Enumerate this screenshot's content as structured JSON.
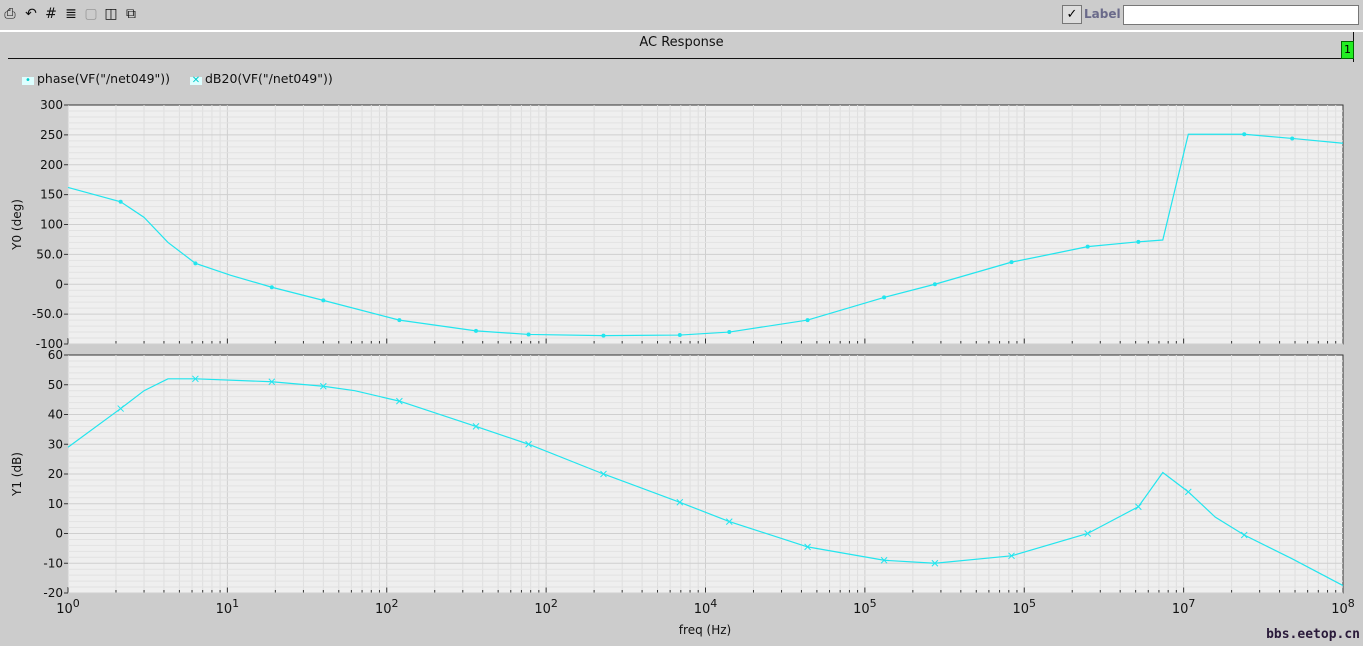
{
  "toolbar": {
    "icons": [
      "print-icon",
      "undo-icon",
      "grid-icon",
      "strips-icon",
      "panel-icon",
      "split-icon",
      "detach-icon"
    ],
    "label_checkbox": true,
    "label_text": "Label",
    "label_input": ""
  },
  "title": "AC Response",
  "page_indicator": "1",
  "watermark": "bbs.eetop.cn",
  "chart_data": [
    {
      "type": "line",
      "ylabel": "Y0 (deg)",
      "ylim": [
        -100,
        300
      ],
      "yticks": [
        "300",
        "250",
        "200",
        "150",
        "100",
        "50.0",
        "0",
        "-50.0",
        "-100"
      ],
      "xscale": "log",
      "xlim": [
        1,
        100000000
      ],
      "grid": true,
      "color": "#22e5ee",
      "marker": "dot",
      "series": [
        {
          "name": "phase(VF(\"/net049\"))",
          "x": [
            1,
            2.14,
            3.0,
            4.24,
            6.3,
            10.5,
            19,
            40,
            120,
            363,
            776,
            2290,
            6900,
            14100,
            43700,
            132000,
            275000,
            832000,
            1450000,
            2500000,
            5200000,
            7400000,
            10700000,
            24000000,
            48000000,
            100000000
          ],
          "y": [
            162,
            138,
            112,
            70,
            35,
            15,
            -5,
            -27,
            -60,
            -78,
            -84,
            -86,
            -85,
            -80,
            -60,
            -22,
            0,
            37,
            50,
            63,
            71,
            74,
            251,
            251,
            244,
            236
          ],
          "markers": [
            1,
            4,
            6,
            7,
            8,
            9,
            10,
            11,
            12,
            13,
            14,
            15,
            16,
            17,
            19,
            20,
            23,
            24
          ]
        }
      ]
    },
    {
      "type": "line",
      "ylabel": "Y1 (dB)",
      "xlabel": "freq (Hz)",
      "ylim": [
        -20,
        60
      ],
      "yticks": [
        "60",
        "50",
        "40",
        "30",
        "20",
        "10",
        "0",
        "-10",
        "-20"
      ],
      "xscale": "log",
      "xlim": [
        1,
        100000000
      ],
      "xticks": [
        {
          "v": 1,
          "b": "10",
          "e": "0"
        },
        {
          "v": 10,
          "b": "10",
          "e": "1"
        },
        {
          "v": 100,
          "b": "10",
          "e": "2"
        },
        {
          "v": 1000,
          "b": "10",
          "e": "2"
        },
        {
          "v": 10000,
          "b": "10",
          "e": "4"
        },
        {
          "v": 100000,
          "b": "10",
          "e": "5"
        },
        {
          "v": 1000000,
          "b": "10",
          "e": "5"
        },
        {
          "v": 10000000,
          "b": "10",
          "e": "7"
        },
        {
          "v": 100000000,
          "b": "10",
          "e": "8"
        }
      ],
      "grid": true,
      "color": "#22e5ee",
      "marker": "x",
      "series": [
        {
          "name": "dB20(VF(\"/net049\"))",
          "x": [
            1,
            2.14,
            3.0,
            4.24,
            6.3,
            19,
            40,
            63,
            120,
            363,
            776,
            2290,
            6900,
            14100,
            43700,
            132000,
            275000,
            832000,
            2500000,
            5200000,
            7400000,
            10700000,
            15800000,
            24000000,
            48000000,
            100000000
          ],
          "y": [
            29,
            42,
            48,
            52,
            52,
            51,
            49.5,
            48,
            44.5,
            36,
            30,
            20,
            10.5,
            4,
            -4.5,
            -9,
            -10,
            -7.5,
            0,
            9,
            20.5,
            14,
            5.5,
            -0.5,
            -8.5,
            -17.5
          ],
          "markers": [
            1,
            4,
            5,
            6,
            8,
            9,
            10,
            11,
            12,
            13,
            14,
            15,
            16,
            17,
            18,
            19,
            21,
            23
          ]
        }
      ]
    }
  ]
}
